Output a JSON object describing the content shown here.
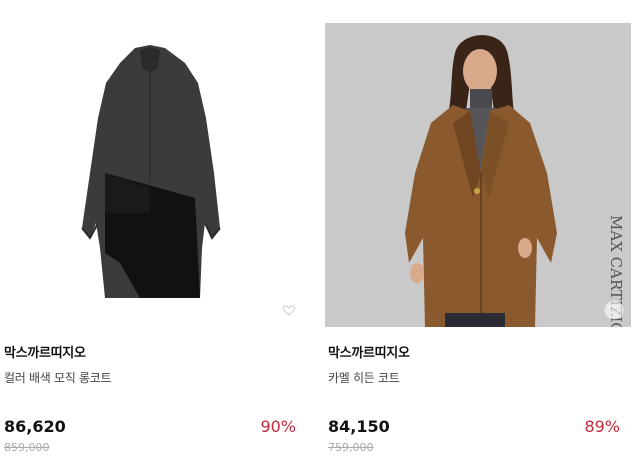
{
  "products": [
    {
      "brand": "막스까르띠지오",
      "name": "컬러 배색 모직 롱코트",
      "price": "86,620",
      "original_price": "859,000",
      "discount": "90%"
    },
    {
      "brand": "막스까르띠지오",
      "name": "카멜 히든 코트",
      "price": "84,150",
      "original_price": "759,000",
      "discount": "89%",
      "watermark": "MAX CARTIZIO"
    }
  ],
  "colors": {
    "discount": "#c62a3c",
    "strike_price": "#aaaaaa",
    "photo_bg": "#c9c9c9"
  }
}
